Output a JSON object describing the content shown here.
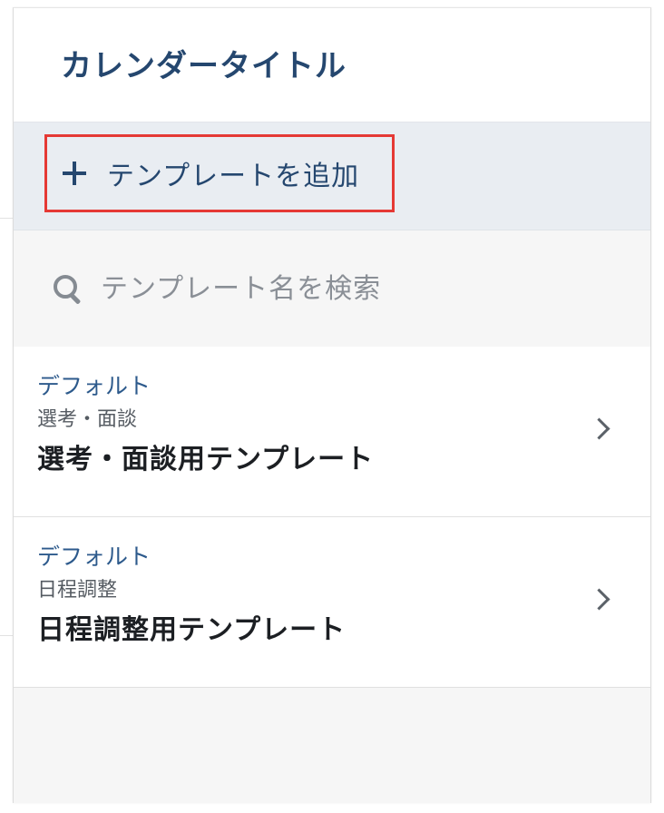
{
  "header": {
    "title": "カレンダータイトル"
  },
  "add_button": {
    "label": "テンプレートを追加"
  },
  "search": {
    "placeholder": "テンプレート名を検索"
  },
  "templates": [
    {
      "tag": "デフォルト",
      "category": "選考・面談",
      "name": "選考・面談用テンプレート"
    },
    {
      "tag": "デフォルト",
      "category": "日程調整",
      "name": "日程調整用テンプレート"
    }
  ],
  "colors": {
    "accent": "#25476f",
    "link": "#2d5a8c",
    "highlight": "#e53935"
  },
  "icons": {
    "add": "plus-icon",
    "search": "search-icon",
    "chevron": "chevron-right-icon"
  }
}
